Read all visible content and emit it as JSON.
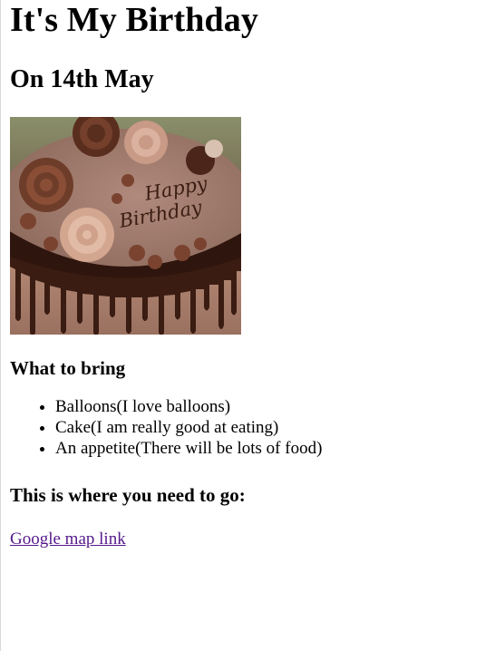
{
  "page": {
    "title": "It's My Birthday",
    "date_heading": "On 14th May",
    "image": {
      "icon": "birthday-cake-image",
      "inscription": "Happy Birthday"
    },
    "bring_heading": "What to bring",
    "bring_items": [
      "Balloons(I love balloons)",
      "Cake(I am really good at eating)",
      "An appetite(There will be lots of food)"
    ],
    "where_heading": "This is where you need to go:",
    "map_link_text": "Google map link"
  },
  "colors": {
    "text": "#000000",
    "visited_link": "#551a8b",
    "background": "#ffffff"
  }
}
